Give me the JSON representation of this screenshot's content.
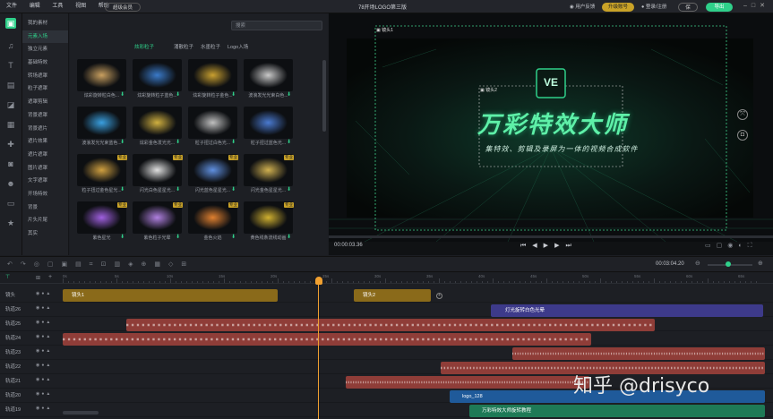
{
  "menu": [
    "文件",
    "编辑",
    "工具",
    "视图",
    "帮助"
  ],
  "user_btn": "超级会员",
  "title": "78开场LOGO第三版",
  "feedback": "用户反馈",
  "upgrade": "升级账号",
  "login": "登录/注册",
  "save": "保存",
  "export": "导出",
  "categories": [
    "我的素材",
    "元素入场",
    "独立元素",
    "基础特效",
    "转场遮罩",
    "粒子遮罩",
    "遮罩剪辑",
    "背景遮罩",
    "背景遮片",
    "遮片效果",
    "遮片遮罩",
    "图片遮罩",
    "文字遮罩",
    "开场特效",
    "背景",
    "片头片尾",
    "其实"
  ],
  "search_placeholder": "搜索",
  "tabs": [
    "炫彩粒子",
    "涌散粒子",
    "水墨粒子",
    "Logo入场"
  ],
  "tiles": [
    [
      "炫彩旋转粒白色...",
      "炫彩旋转粒子蓝色...",
      "炫彩旋转粒子金色...",
      "波浪发光光束白色..."
    ],
    [
      "波浪发光光束蓝色...",
      "炫彩金色发光光...",
      "粒子扭过白色光...",
      "粒子扭过蓝色光..."
    ],
    [
      "粒子扭过金色星光...",
      "闪光白色星星光...",
      "闪光蓝色星星光...",
      "闪光金色星星光..."
    ],
    [
      "紫色星光",
      "紫色粒子光晕",
      "金色火焰",
      "黄色线条流线动画"
    ]
  ],
  "tile_badge": "专业",
  "preview": {
    "title_main": "万彩特效大师",
    "subtitle": "集特效、剪辑及录屏为一体的视频合成软件",
    "logo": "VE",
    "label1": "镜头1",
    "label2": "镜头2",
    "timecode": "00:00:03.36"
  },
  "toolbar_time": "00:03:04.20",
  "ruler_marks": [
    "0s",
    "5s",
    "10s",
    "15s",
    "20s",
    "25s",
    "30s",
    "35s",
    "40s",
    "45s",
    "50s",
    "55s",
    "60s",
    "65s"
  ],
  "tracks": [
    "镜头",
    "轨道26",
    "轨道25",
    "轨道24",
    "轨道23",
    "轨道22",
    "轨道21",
    "轨道20",
    "轨道19"
  ],
  "clips": {
    "shot1": "镜头1",
    "shot2": "镜头2",
    "purple": "灯光旋转白色光晕",
    "logo": "logo_128",
    "green": "万彩特效大师旋转教程"
  },
  "watermark": "知乎 @drisyco",
  "colors": {
    "accent": "#2fd08a",
    "gold": "#8a6a1a",
    "red": "#8f3d38",
    "purple": "#3d3a8a",
    "blue": "#1f5a9a"
  }
}
